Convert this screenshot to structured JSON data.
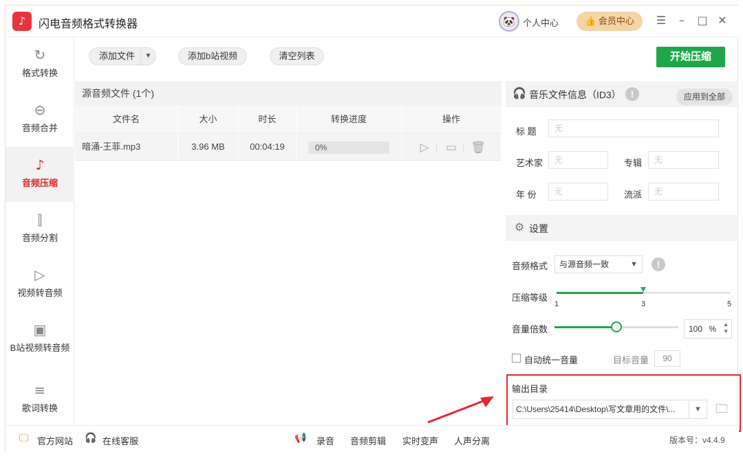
{
  "app": {
    "title": "闪电音频格式转换器",
    "logo_glyph": "♪"
  },
  "header": {
    "user_center": "个人中心",
    "vip_center": "会员中心",
    "vip_icon": "thumbs-up-icon",
    "window_controls": [
      "☰",
      "–",
      "□",
      "✕"
    ]
  },
  "sidebar": {
    "items": [
      {
        "label": "格式转换",
        "icon": "↻",
        "active": false
      },
      {
        "label": "音频合并",
        "icon": "⊖",
        "active": false
      },
      {
        "label": "音频压缩",
        "icon": "♪",
        "active": true
      },
      {
        "label": "音频分割",
        "icon": "⫿",
        "active": false
      },
      {
        "label": "视频转音频",
        "icon": "▷",
        "active": false
      },
      {
        "label": "B站视频转音频",
        "icon": "▣",
        "active": false
      },
      {
        "label": "歌词转换",
        "icon": "≡",
        "active": false
      }
    ]
  },
  "toolbar": {
    "add_file": "添加文件",
    "add_bilibili": "添加b站视频",
    "clear_list": "清空列表",
    "start": "开始压缩"
  },
  "file_list": {
    "header": "源音频文件 (1个)",
    "columns": [
      "文件名",
      "大小",
      "时长",
      "转换进度",
      "操作"
    ],
    "rows": [
      {
        "name": "暗涌-王菲.mp3",
        "size": "3.96 MB",
        "duration": "00:04:19",
        "progress": "0%"
      }
    ]
  },
  "id3": {
    "title": "音乐文件信息（ID3）",
    "apply_all": "应用到全部",
    "fields": {
      "title_label": "标  题",
      "artist_label": "艺术家",
      "album_label": "专辑",
      "year_label": "年  份",
      "genre_label": "流派",
      "placeholder": "无"
    }
  },
  "settings": {
    "title": "设置",
    "format_label": "音频格式",
    "format_value": "与源音频一致",
    "compress_label": "压缩等级",
    "compress_ticks": [
      "1",
      "3",
      "5"
    ],
    "compress_level": 3,
    "volume_label": "音量倍数",
    "volume_value": "100",
    "volume_unit": "%",
    "volume_fraction": 0.5,
    "auto_volume_label": "自动统一音量",
    "target_volume_label": "目标音量",
    "target_volume_value": "90"
  },
  "output": {
    "label": "输出目录",
    "path": "C:\\Users\\25414\\Desktop\\写文章用的文件\\..."
  },
  "footer": {
    "website": "官方网站",
    "support": "在线客服",
    "record": "录音",
    "edit": "音频剪辑",
    "voice_change": "实时变声",
    "vocal_split": "人声分离",
    "version": "版本号：v4.4.9"
  },
  "colors": {
    "accent": "#e0282e",
    "primary_button": "#1fa64a",
    "highlight_frame": "#e8262b"
  }
}
